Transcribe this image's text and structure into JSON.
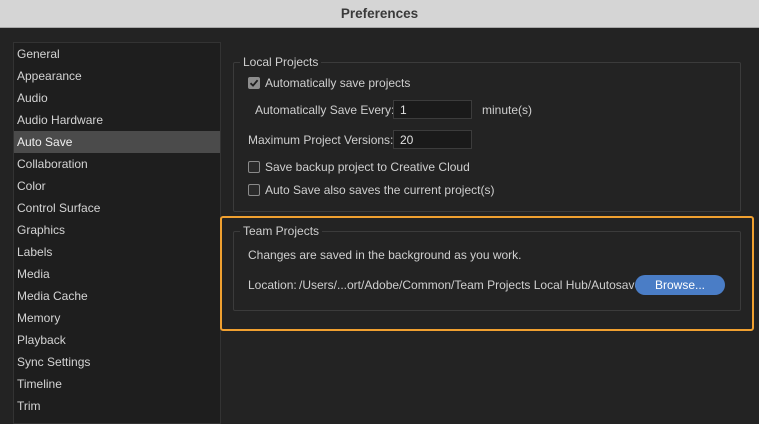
{
  "window": {
    "title": "Preferences"
  },
  "sidebar": {
    "items": [
      {
        "label": "General"
      },
      {
        "label": "Appearance"
      },
      {
        "label": "Audio"
      },
      {
        "label": "Audio Hardware"
      },
      {
        "label": "Auto Save",
        "selected": true
      },
      {
        "label": "Collaboration"
      },
      {
        "label": "Color"
      },
      {
        "label": "Control Surface"
      },
      {
        "label": "Graphics"
      },
      {
        "label": "Labels"
      },
      {
        "label": "Media"
      },
      {
        "label": "Media Cache"
      },
      {
        "label": "Memory"
      },
      {
        "label": "Playback"
      },
      {
        "label": "Sync Settings"
      },
      {
        "label": "Timeline"
      },
      {
        "label": "Trim"
      }
    ]
  },
  "local_projects": {
    "title": "Local Projects",
    "auto_save_checkbox": {
      "label": "Automatically save projects",
      "checked": true
    },
    "save_every": {
      "label": "Automatically Save Every:",
      "value": "1",
      "unit": "minute(s)"
    },
    "max_versions": {
      "label": "Maximum Project Versions:",
      "value": "20"
    },
    "backup_cloud_checkbox": {
      "label": "Save backup project to Creative Cloud",
      "checked": false
    },
    "current_project_checkbox": {
      "label": "Auto Save also saves the current project(s)",
      "checked": false
    }
  },
  "team_projects": {
    "title": "Team Projects",
    "description": "Changes are saved in the background as you work.",
    "location_label": "Location:",
    "location_path": "/Users/...ort/Adobe/Common/Team Projects Local Hub/Autosaves",
    "browse_label": "Browse..."
  },
  "colors": {
    "highlight": "#f0a030",
    "button_accent": "#4a7dc6",
    "selected_item_bg": "#4b4b4b"
  }
}
